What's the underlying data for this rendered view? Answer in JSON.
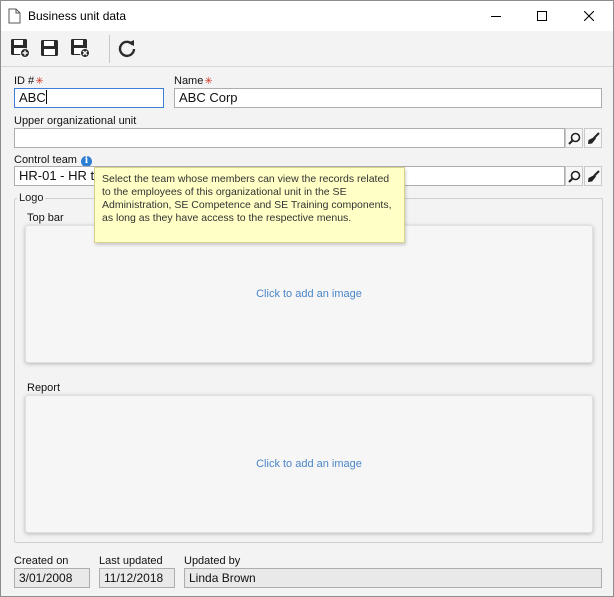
{
  "window": {
    "title": "Business unit data"
  },
  "fields": {
    "id": {
      "label": "ID #",
      "value": "ABC"
    },
    "name": {
      "label": "Name",
      "value": "ABC Corp"
    },
    "upper_unit": {
      "label": "Upper organizational unit",
      "value": ""
    },
    "control_team": {
      "label": "Control team",
      "value": "HR-01 - HR t"
    }
  },
  "required_mark": "✳",
  "info_mark": "i",
  "tooltip": {
    "text": "Select the team whose members can view the records related to the employees of this organizational unit in the SE Administration, SE Competence and SE Training components, as long as they have access to the respective menus."
  },
  "logo": {
    "group_label": "Logo",
    "top_bar": {
      "label": "Top bar",
      "placeholder": "Click to add an image"
    },
    "report": {
      "label": "Report",
      "placeholder": "Click to add an image"
    }
  },
  "footer": {
    "created_on": {
      "label": "Created on",
      "value": "3/01/2008"
    },
    "last_updated": {
      "label": "Last updated",
      "value": "11/12/2018"
    },
    "updated_by": {
      "label": "Updated by",
      "value": "Linda Brown"
    }
  },
  "icons": {
    "title": "document-icon",
    "save_new": "save-and-new-icon",
    "save": "save-icon",
    "save_close": "save-and-close-icon",
    "refresh": "refresh-icon",
    "search": "magnifier-icon",
    "clear": "eraser-brush-icon"
  },
  "colors": {
    "accent": "#3c7fd8",
    "link": "#4a86c8",
    "required": "#d0342c",
    "tooltip_bg": "#ffffc6"
  }
}
